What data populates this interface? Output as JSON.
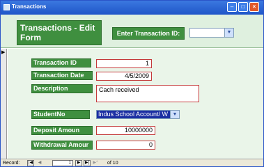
{
  "window": {
    "title": "Transactions"
  },
  "header": {
    "form_title": "Transactions - Edit Form",
    "id_label": "Enter Transaction ID:",
    "id_value": ""
  },
  "fields": {
    "transaction_id": {
      "label": "Transaction ID",
      "value": "1"
    },
    "transaction_date": {
      "label": "Transaction Date",
      "value": "4/5/2009"
    },
    "description": {
      "label": "Description",
      "value": "Cach received"
    },
    "student_no": {
      "label": "StudentNo",
      "value": "Indus School Account/ W"
    },
    "deposit_amount": {
      "label": "Deposit Amoun",
      "value": "10000000"
    },
    "withdrawal_amount": {
      "label": "Withdrawal Amour",
      "value": "0"
    }
  },
  "navigation": {
    "record_label": "Record:",
    "current": "1",
    "of_label": "of",
    "total": "10"
  },
  "colors": {
    "label_bg": "#3f8f3f",
    "header_bg": "#dff0df",
    "body_bg": "#eaf5e9",
    "field_border": "#c43a3a",
    "titlebar": "#2458d0",
    "selection": "#1c2fa3"
  },
  "icons": [
    "form-icon",
    "minimize-icon",
    "maximize-icon",
    "close-icon",
    "dropdown-arrow-icon",
    "record-selector-icon",
    "first-record-icon",
    "previous-record-icon",
    "next-record-icon",
    "last-record-icon",
    "new-record-icon"
  ]
}
